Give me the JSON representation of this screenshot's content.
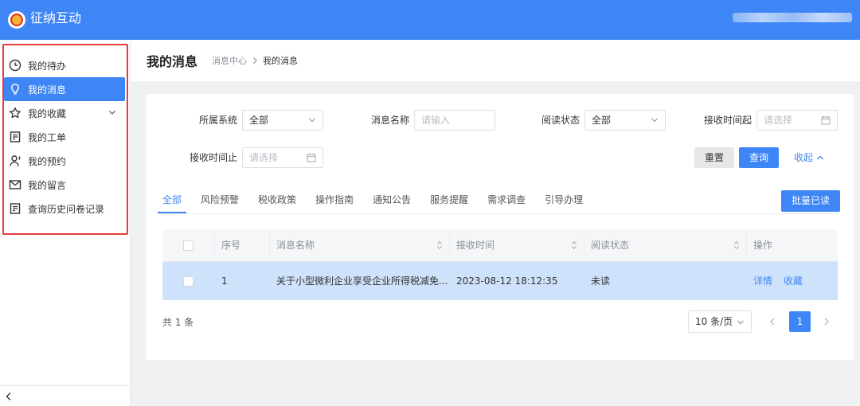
{
  "header": {
    "app_title": "征纳互动"
  },
  "sidebar": {
    "items": [
      {
        "label": "我的待办",
        "icon": "clock-icon",
        "active": false
      },
      {
        "label": "我的消息",
        "icon": "lightbulb-icon",
        "active": true
      },
      {
        "label": "我的收藏",
        "icon": "star-icon",
        "active": false,
        "expandable": true
      },
      {
        "label": "我的工单",
        "icon": "document-icon",
        "active": false
      },
      {
        "label": "我的预约",
        "icon": "person-icon",
        "active": false
      },
      {
        "label": "我的留言",
        "icon": "mail-icon",
        "active": false
      },
      {
        "label": "查询历史问卷记录",
        "icon": "document-icon",
        "active": false
      }
    ]
  },
  "page": {
    "title": "我的消息",
    "breadcrumb": {
      "parent": "消息中心",
      "current": "我的消息"
    }
  },
  "filters": {
    "system": {
      "label": "所属系统",
      "value": "全部"
    },
    "name": {
      "label": "消息名称",
      "placeholder": "请输入"
    },
    "read_status": {
      "label": "阅读状态",
      "value": "全部"
    },
    "recv_start": {
      "label": "接收时间起",
      "placeholder": "请选择"
    },
    "recv_end": {
      "label": "接收时间止",
      "placeholder": "请选择"
    },
    "reset_label": "重置",
    "query_label": "查询",
    "collapse_label": "收起"
  },
  "tabs": [
    "全部",
    "风险预警",
    "税收政策",
    "操作指南",
    "通知公告",
    "服务提醒",
    "需求调查",
    "引导办理"
  ],
  "batch_read_label": "批量已读",
  "table": {
    "columns": [
      "序号",
      "消息名称",
      "接收时间",
      "阅读状态",
      "操作"
    ],
    "rows": [
      {
        "index": "1",
        "name": "关于小型微利企业享受企业所得税减免...",
        "time": "2023-08-12 18:12:35",
        "status": "未读",
        "actions": [
          "详情",
          "收藏"
        ]
      }
    ]
  },
  "pagination": {
    "total_text": "共 1 条",
    "page_size": "10 条/页",
    "current_page": "1"
  },
  "colors": {
    "primary": "#3e86f6",
    "highlight_row": "#cfe2fb",
    "outline_red": "#e63b3b"
  }
}
